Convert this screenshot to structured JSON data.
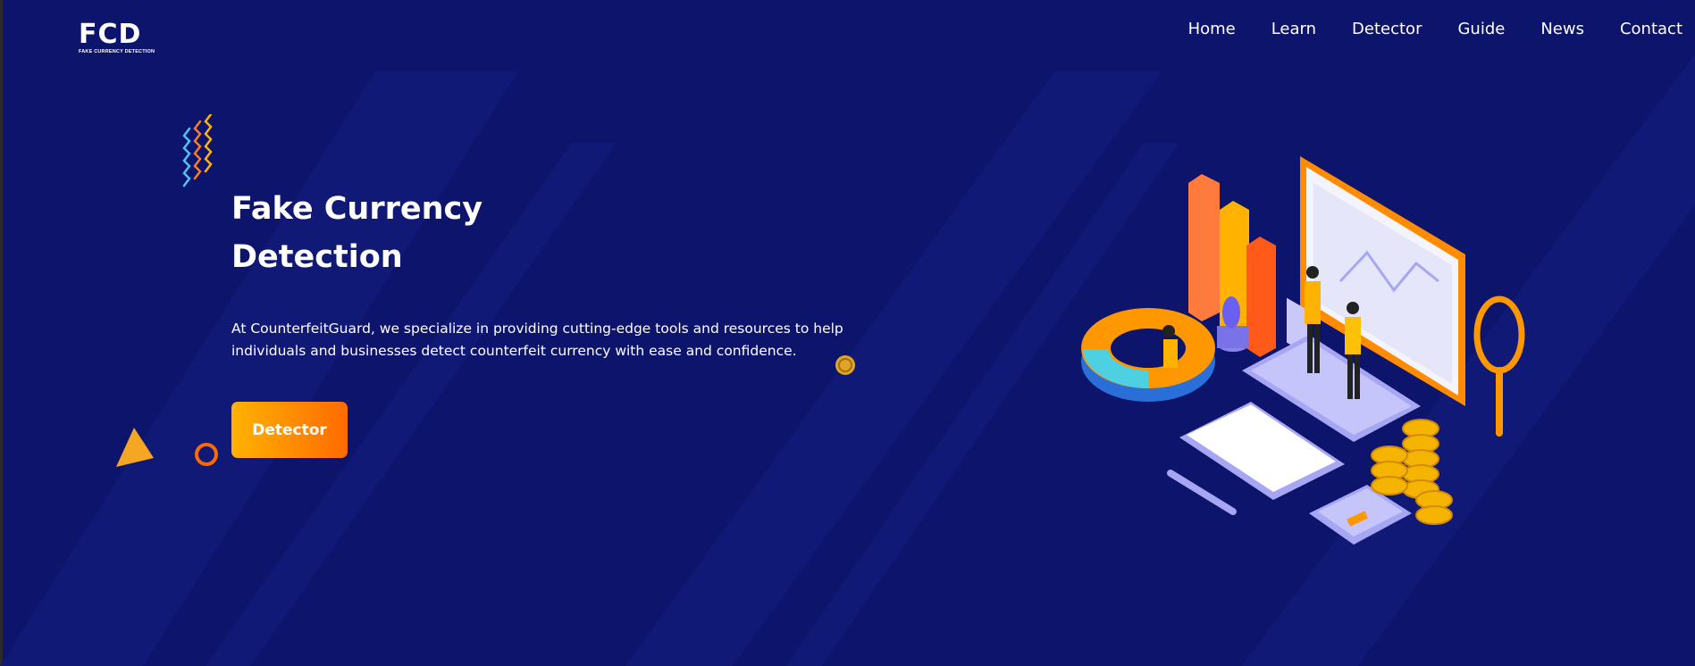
{
  "header": {
    "logo_text": "FCD",
    "logo_subtitle": "FAKE CURRENCY DETECTION",
    "nav": [
      "Home",
      "Learn",
      "Detector",
      "Guide",
      "News",
      "Contact"
    ]
  },
  "hero": {
    "title_line1": "Fake Currency",
    "title_line2": "Detection",
    "description": "At CounterfeitGuard, we specialize in providing cutting-edge tools and resources to help individuals and businesses detect counterfeit currency with ease and confidence.",
    "cta_label": "Detector"
  },
  "colors": {
    "background": "#0d146b",
    "accent_orange": "#ff6a00",
    "accent_yellow": "#ffb300",
    "illustration_purple": "#a7a6f5"
  },
  "icons": [
    "squiggle-icon",
    "triangle-icon",
    "ring-icon",
    "coin-icon"
  ]
}
